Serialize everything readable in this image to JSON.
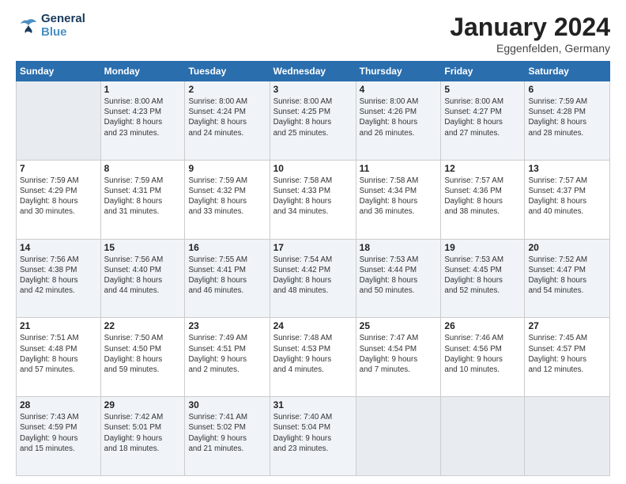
{
  "header": {
    "logo_line1": "General",
    "logo_line2": "Blue",
    "month": "January 2024",
    "location": "Eggenfelden, Germany"
  },
  "days_of_week": [
    "Sunday",
    "Monday",
    "Tuesday",
    "Wednesday",
    "Thursday",
    "Friday",
    "Saturday"
  ],
  "weeks": [
    [
      {
        "num": "",
        "info": ""
      },
      {
        "num": "1",
        "info": "Sunrise: 8:00 AM\nSunset: 4:23 PM\nDaylight: 8 hours\nand 23 minutes."
      },
      {
        "num": "2",
        "info": "Sunrise: 8:00 AM\nSunset: 4:24 PM\nDaylight: 8 hours\nand 24 minutes."
      },
      {
        "num": "3",
        "info": "Sunrise: 8:00 AM\nSunset: 4:25 PM\nDaylight: 8 hours\nand 25 minutes."
      },
      {
        "num": "4",
        "info": "Sunrise: 8:00 AM\nSunset: 4:26 PM\nDaylight: 8 hours\nand 26 minutes."
      },
      {
        "num": "5",
        "info": "Sunrise: 8:00 AM\nSunset: 4:27 PM\nDaylight: 8 hours\nand 27 minutes."
      },
      {
        "num": "6",
        "info": "Sunrise: 7:59 AM\nSunset: 4:28 PM\nDaylight: 8 hours\nand 28 minutes."
      }
    ],
    [
      {
        "num": "7",
        "info": "Sunrise: 7:59 AM\nSunset: 4:29 PM\nDaylight: 8 hours\nand 30 minutes."
      },
      {
        "num": "8",
        "info": "Sunrise: 7:59 AM\nSunset: 4:31 PM\nDaylight: 8 hours\nand 31 minutes."
      },
      {
        "num": "9",
        "info": "Sunrise: 7:59 AM\nSunset: 4:32 PM\nDaylight: 8 hours\nand 33 minutes."
      },
      {
        "num": "10",
        "info": "Sunrise: 7:58 AM\nSunset: 4:33 PM\nDaylight: 8 hours\nand 34 minutes."
      },
      {
        "num": "11",
        "info": "Sunrise: 7:58 AM\nSunset: 4:34 PM\nDaylight: 8 hours\nand 36 minutes."
      },
      {
        "num": "12",
        "info": "Sunrise: 7:57 AM\nSunset: 4:36 PM\nDaylight: 8 hours\nand 38 minutes."
      },
      {
        "num": "13",
        "info": "Sunrise: 7:57 AM\nSunset: 4:37 PM\nDaylight: 8 hours\nand 40 minutes."
      }
    ],
    [
      {
        "num": "14",
        "info": "Sunrise: 7:56 AM\nSunset: 4:38 PM\nDaylight: 8 hours\nand 42 minutes."
      },
      {
        "num": "15",
        "info": "Sunrise: 7:56 AM\nSunset: 4:40 PM\nDaylight: 8 hours\nand 44 minutes."
      },
      {
        "num": "16",
        "info": "Sunrise: 7:55 AM\nSunset: 4:41 PM\nDaylight: 8 hours\nand 46 minutes."
      },
      {
        "num": "17",
        "info": "Sunrise: 7:54 AM\nSunset: 4:42 PM\nDaylight: 8 hours\nand 48 minutes."
      },
      {
        "num": "18",
        "info": "Sunrise: 7:53 AM\nSunset: 4:44 PM\nDaylight: 8 hours\nand 50 minutes."
      },
      {
        "num": "19",
        "info": "Sunrise: 7:53 AM\nSunset: 4:45 PM\nDaylight: 8 hours\nand 52 minutes."
      },
      {
        "num": "20",
        "info": "Sunrise: 7:52 AM\nSunset: 4:47 PM\nDaylight: 8 hours\nand 54 minutes."
      }
    ],
    [
      {
        "num": "21",
        "info": "Sunrise: 7:51 AM\nSunset: 4:48 PM\nDaylight: 8 hours\nand 57 minutes."
      },
      {
        "num": "22",
        "info": "Sunrise: 7:50 AM\nSunset: 4:50 PM\nDaylight: 8 hours\nand 59 minutes."
      },
      {
        "num": "23",
        "info": "Sunrise: 7:49 AM\nSunset: 4:51 PM\nDaylight: 9 hours\nand 2 minutes."
      },
      {
        "num": "24",
        "info": "Sunrise: 7:48 AM\nSunset: 4:53 PM\nDaylight: 9 hours\nand 4 minutes."
      },
      {
        "num": "25",
        "info": "Sunrise: 7:47 AM\nSunset: 4:54 PM\nDaylight: 9 hours\nand 7 minutes."
      },
      {
        "num": "26",
        "info": "Sunrise: 7:46 AM\nSunset: 4:56 PM\nDaylight: 9 hours\nand 10 minutes."
      },
      {
        "num": "27",
        "info": "Sunrise: 7:45 AM\nSunset: 4:57 PM\nDaylight: 9 hours\nand 12 minutes."
      }
    ],
    [
      {
        "num": "28",
        "info": "Sunrise: 7:43 AM\nSunset: 4:59 PM\nDaylight: 9 hours\nand 15 minutes."
      },
      {
        "num": "29",
        "info": "Sunrise: 7:42 AM\nSunset: 5:01 PM\nDaylight: 9 hours\nand 18 minutes."
      },
      {
        "num": "30",
        "info": "Sunrise: 7:41 AM\nSunset: 5:02 PM\nDaylight: 9 hours\nand 21 minutes."
      },
      {
        "num": "31",
        "info": "Sunrise: 7:40 AM\nSunset: 5:04 PM\nDaylight: 9 hours\nand 23 minutes."
      },
      {
        "num": "",
        "info": ""
      },
      {
        "num": "",
        "info": ""
      },
      {
        "num": "",
        "info": ""
      }
    ]
  ]
}
